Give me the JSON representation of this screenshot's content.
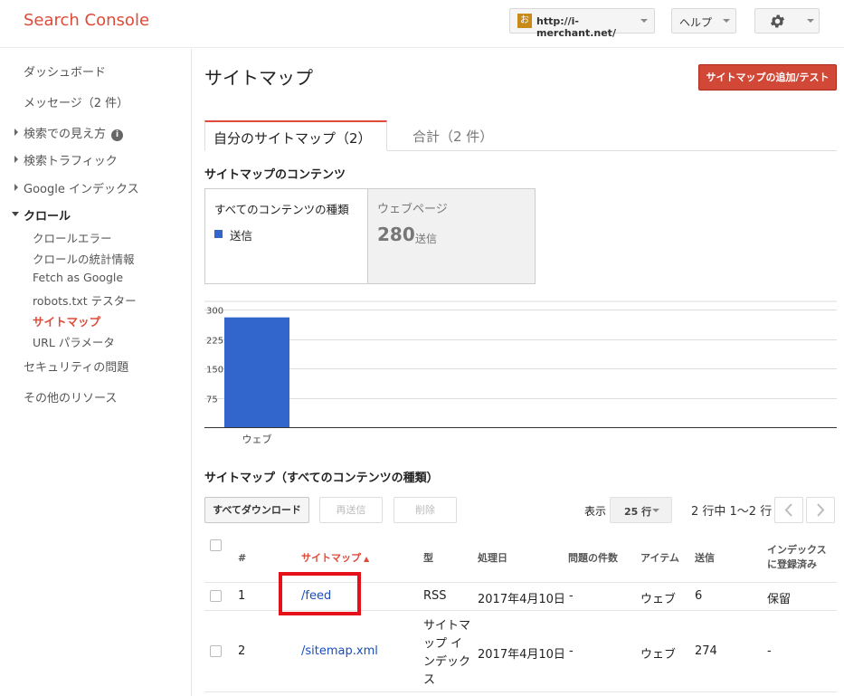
{
  "header": {
    "logo": "Search Console",
    "site_favicon": "お",
    "site_url": "http://i-merchant.net/",
    "help_label": "ヘルプ",
    "gear_icon": "gear-icon"
  },
  "sidebar": {
    "items": [
      {
        "label": "ダッシュボード"
      },
      {
        "label": "メッセージ（2 件）"
      },
      {
        "label": "検索での見え方",
        "info": "i"
      },
      {
        "label": "検索トラフィック"
      },
      {
        "label": "Google インデックス"
      },
      {
        "label": "クロール"
      },
      {
        "label": "クロールエラー"
      },
      {
        "label": "クロールの統計情報"
      },
      {
        "label": "Fetch as Google"
      },
      {
        "label": "robots.txt テスター"
      },
      {
        "label": "サイトマップ"
      },
      {
        "label": "URL パラメータ"
      },
      {
        "label": "セキュリティの問題"
      },
      {
        "label": "その他のリソース"
      }
    ]
  },
  "main": {
    "title": "サイトマップ",
    "add_button": "サイトマップの追加/テスト",
    "tabs": [
      {
        "label": "自分のサイトマップ（2）",
        "active": true
      },
      {
        "label": "合計（2 件）",
        "active": false
      }
    ],
    "contents_title": "サイトマップのコンテンツ",
    "cards": [
      {
        "title": "すべてのコンテンツの種類",
        "legend": "送信",
        "legend_color": "#3366cc"
      },
      {
        "title": "ウェブページ",
        "value": "280",
        "unit": "送信"
      }
    ],
    "table_title": "サイトマップ（すべてのコンテンツの種類）",
    "toolbar": {
      "download_all": "すべてダウンロード",
      "resend": "再送信",
      "delete": "削除",
      "show_label": "表示",
      "rows_per_page": "25 行",
      "range": "2 行中 1〜2 行"
    }
  },
  "chart_data": {
    "type": "bar",
    "categories": [
      "ウェブ"
    ],
    "series": [
      {
        "name": "送信",
        "values": [
          280
        ],
        "color": "#3366cc"
      }
    ],
    "yticks": [
      75,
      150,
      225,
      300
    ],
    "ylim": [
      0,
      300
    ],
    "grid": true
  },
  "table": {
    "columns": [
      "#",
      "サイトマップ",
      "型",
      "処理日",
      "問題の件数",
      "アイテム",
      "送信",
      "インデックスに登録済み"
    ],
    "index_col_l1": "インデックス",
    "index_col_l2": "に登録済み",
    "rows": [
      {
        "num": "1",
        "sitemap": "/feed",
        "type": "RSS",
        "date": "2017年4月10日",
        "issues": "-",
        "item": "ウェブ",
        "submitted": "6",
        "indexed": "保留"
      },
      {
        "num": "2",
        "sitemap": "/sitemap.xml",
        "type_lines": [
          "サイトマ",
          "ップ イ",
          "ンデック",
          "ス"
        ],
        "date": "2017年4月10日",
        "issues": "-",
        "item": "ウェブ",
        "submitted": "274",
        "indexed": "-"
      }
    ]
  }
}
